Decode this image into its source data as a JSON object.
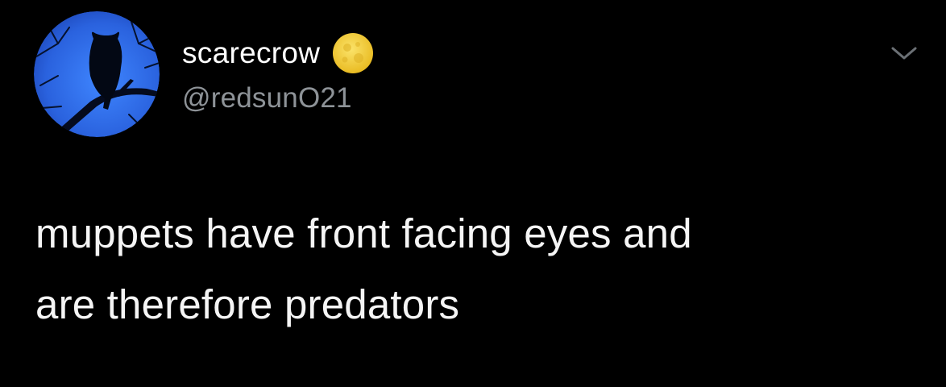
{
  "tweet": {
    "author": {
      "display_name": "scarecrow",
      "handle": "@redsunO21",
      "avatar_icon": "owl-silhouette-avatar",
      "name_emoji": "full-moon-emoji"
    },
    "menu_icon": "chevron-down-icon",
    "text_lines": [
      "muppets have front facing eyes and",
      "are therefore predators"
    ]
  },
  "colors": {
    "background": "#000000",
    "primary_text": "#ffffff",
    "secondary_text": "#8e9398",
    "avatar_sky": "#2d6be4",
    "moon": "#f3cf3a"
  }
}
